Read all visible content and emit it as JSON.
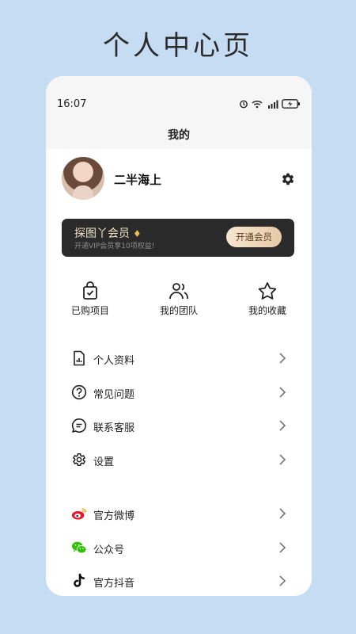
{
  "page_heading": "个人中心页",
  "status_bar": {
    "time": "16:07"
  },
  "nav": {
    "title": "我的"
  },
  "profile": {
    "username": "二半海上"
  },
  "vip": {
    "title": "探图丫会员",
    "subtitle": "开通VIP会员享10项权益!",
    "button_label": "开通会员"
  },
  "quick_actions": [
    {
      "label": "已购项目",
      "icon": "shopping-bag-check-icon"
    },
    {
      "label": "我的团队",
      "icon": "team-users-icon"
    },
    {
      "label": "我的收藏",
      "icon": "star-icon"
    }
  ],
  "menu": [
    {
      "label": "个人资料",
      "icon": "profile-document-icon"
    },
    {
      "label": "常见问题",
      "icon": "question-circle-icon"
    },
    {
      "label": "联系客服",
      "icon": "chat-bubble-icon"
    },
    {
      "label": "设置",
      "icon": "gear-icon"
    }
  ],
  "social": [
    {
      "label": "官方微博",
      "icon": "weibo-icon",
      "color": "#e6162d"
    },
    {
      "label": "公众号",
      "icon": "wechat-icon",
      "color": "#2dc100"
    },
    {
      "label": "官方抖音",
      "icon": "tiktok-icon",
      "color": "#111111"
    }
  ],
  "colors": {
    "background": "#c6dcf3",
    "vip_card": "#2a2a2a",
    "vip_gold": "#f1e1c7"
  }
}
